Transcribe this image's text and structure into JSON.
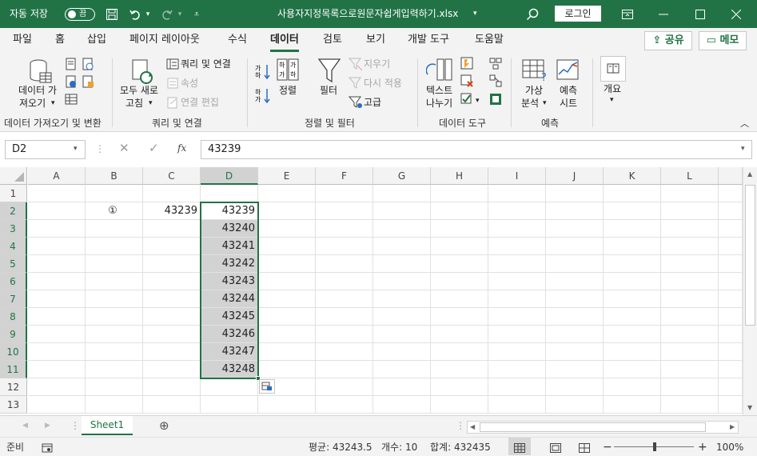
{
  "titlebar": {
    "autosave_label": "자동 저장",
    "autosave_state": "끔",
    "file_title": "사용자지정목록으로원문자쉽게입력하기.xlsx",
    "login_label": "로그인",
    "bg_color": "#217346"
  },
  "tabs": [
    "파일",
    "홈",
    "삽입",
    "페이지 레이아웃",
    "수식",
    "데이터",
    "검토",
    "보기",
    "개발 도구",
    "도움말"
  ],
  "active_tab": "데이터",
  "share_label": "공유",
  "memo_label": "메모",
  "ribbon": {
    "get_data": {
      "line1": "데이터 가",
      "line2": "져오기"
    },
    "refresh_all": {
      "line1": "모두 새로",
      "line2": "고침"
    },
    "queries_connections": "쿼리 및 연결",
    "properties": "속성",
    "edit_links": "연결 편집",
    "sort": "정렬",
    "filter": "필터",
    "clear": "지우기",
    "reapply": "다시 적용",
    "advanced": "고급",
    "text_to_columns": {
      "line1": "텍스트",
      "line2": "나누기"
    },
    "what_if": {
      "line1": "가상",
      "line2": "분석"
    },
    "forecast_sheet": {
      "line1": "예측",
      "line2": "시트"
    },
    "outline": "개요",
    "groups": {
      "get_transform": "데이터 가져오기 및 변환",
      "queries": "쿼리 및 연결",
      "sort_filter": "정렬 및 필터",
      "data_tools": "데이터 도구",
      "forecast": "예측"
    }
  },
  "formula_bar": {
    "name_box": "D2",
    "fx": "fx",
    "value": "43239"
  },
  "columns": [
    "A",
    "B",
    "C",
    "D",
    "E",
    "F",
    "G",
    "H",
    "I",
    "J",
    "K",
    "L"
  ],
  "selected_column": "D",
  "rows": [
    "1",
    "2",
    "3",
    "4",
    "5",
    "6",
    "7",
    "8",
    "9",
    "10",
    "11",
    "12",
    "13"
  ],
  "cells": {
    "B2": "①",
    "C2": "43239",
    "D2": "43239",
    "D3": "43240",
    "D4": "43241",
    "D5": "43242",
    "D6": "43243",
    "D7": "43244",
    "D8": "43245",
    "D9": "43246",
    "D10": "43247",
    "D11": "43248"
  },
  "sheet_tab": "Sheet1",
  "status": {
    "ready": "준비",
    "average": "평균: 43243.5",
    "count": "개수: 10",
    "sum": "합계: 432435",
    "zoom": "100%"
  },
  "accent_color": "#217346"
}
